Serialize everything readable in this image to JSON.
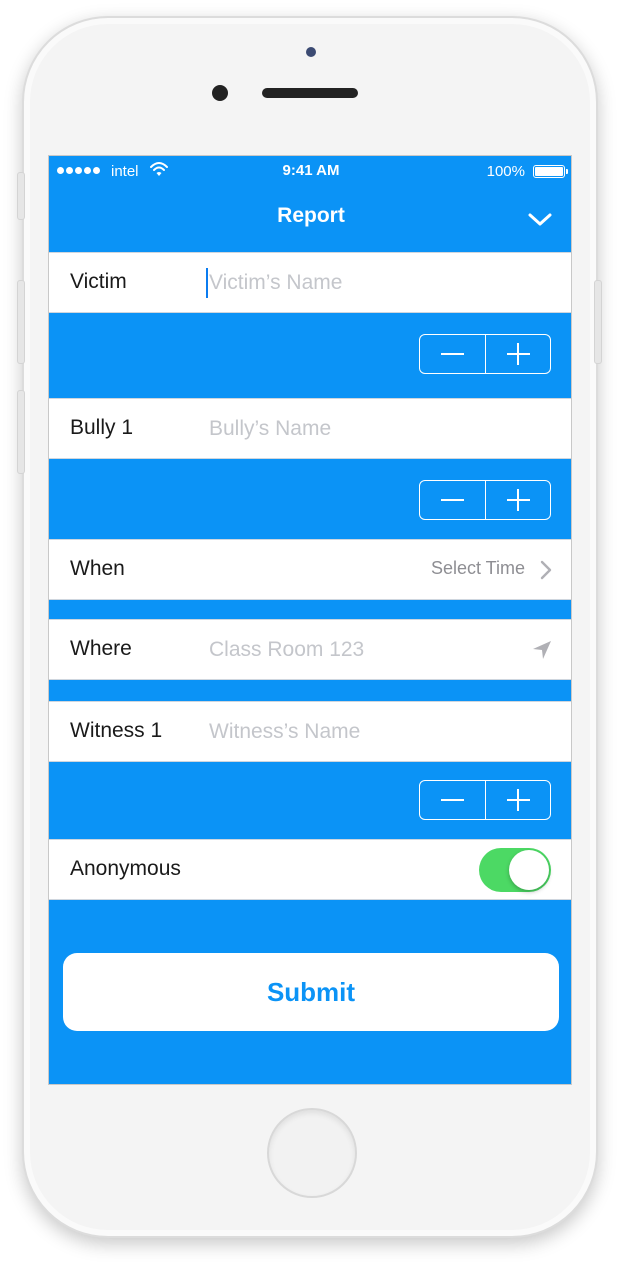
{
  "status_bar": {
    "carrier": "intel",
    "time": "9:41 AM",
    "battery": "100%",
    "signal_bars": 5
  },
  "nav": {
    "title": "Report",
    "chevron_icon": "chevron-down-icon"
  },
  "form": {
    "victim": {
      "label": "Victim",
      "placeholder": "Victim’s Name"
    },
    "bully": {
      "label": "Bully 1",
      "placeholder": "Bully’s Name"
    },
    "when": {
      "label": "When",
      "detail": "Select Time"
    },
    "where": {
      "label": "Where",
      "placeholder": "Class Room 123",
      "icon": "location-arrow-icon"
    },
    "witness": {
      "label": "Witness 1",
      "placeholder": "Witness’s Name"
    },
    "anonymous": {
      "label": "Anonymous",
      "enabled": true
    }
  },
  "submit_label": "Submit",
  "colors": {
    "accent": "#0b93f6",
    "toggle_on": "#4cd964",
    "placeholder": "#c4c6cb",
    "detail_text": "#8e8e93"
  }
}
